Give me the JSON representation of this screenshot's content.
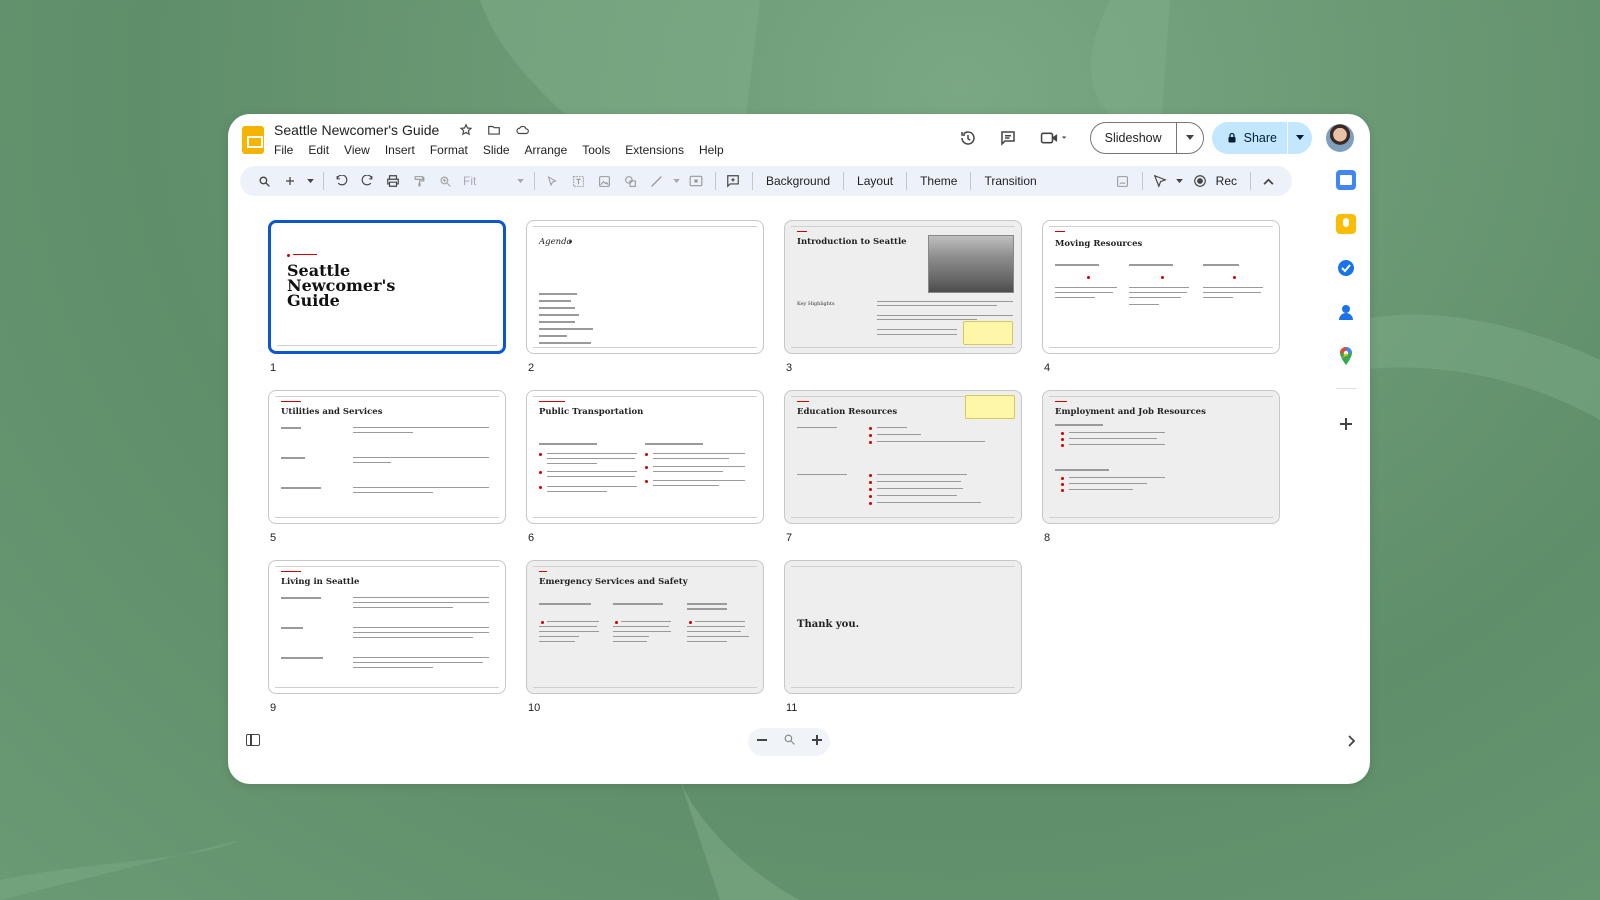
{
  "app": {
    "title": "Seattle Newcomer's Guide",
    "menu": [
      "File",
      "Edit",
      "View",
      "Insert",
      "Format",
      "Slide",
      "Arrange",
      "Tools",
      "Extensions",
      "Help"
    ],
    "slideshow_label": "Slideshow",
    "share_label": "Share"
  },
  "toolbar": {
    "zoom_value": "Fit",
    "background_label": "Background",
    "layout_label": "Layout",
    "theme_label": "Theme",
    "transition_label": "Transition",
    "rec_label": "Rec"
  },
  "slides": [
    {
      "number": "1",
      "title": "Seattle Newcomer's Guide",
      "selected": true
    },
    {
      "number": "2",
      "title": "Agenda"
    },
    {
      "number": "3",
      "title": "Introduction to Seattle",
      "subtitle": "Key Highlights"
    },
    {
      "number": "4",
      "title": "Moving Resources"
    },
    {
      "number": "5",
      "title": "Utilities and Services"
    },
    {
      "number": "6",
      "title": "Public Transportation"
    },
    {
      "number": "7",
      "title": "Education Resources"
    },
    {
      "number": "8",
      "title": "Employment and Job Resources"
    },
    {
      "number": "9",
      "title": "Living in Seattle"
    },
    {
      "number": "10",
      "title": "Emergency Services and Safety"
    },
    {
      "number": "11",
      "title": "Thank you."
    }
  ],
  "icons": {
    "star": "star-icon",
    "folder": "move-to-folder-icon",
    "cloud": "cloud-status-icon",
    "history": "version-history-icon",
    "comments": "comments-icon",
    "meet": "video-call-icon",
    "lock": "lock-icon",
    "zoom_out": "zoom-out-icon",
    "zoom_in": "zoom-in-icon"
  },
  "colors": {
    "accent": "#0b57d0",
    "share_bg": "#c2e7ff",
    "logo": "#f4b400",
    "toolbar_bg": "#edf2fa",
    "red_accent": "#cc0000"
  }
}
